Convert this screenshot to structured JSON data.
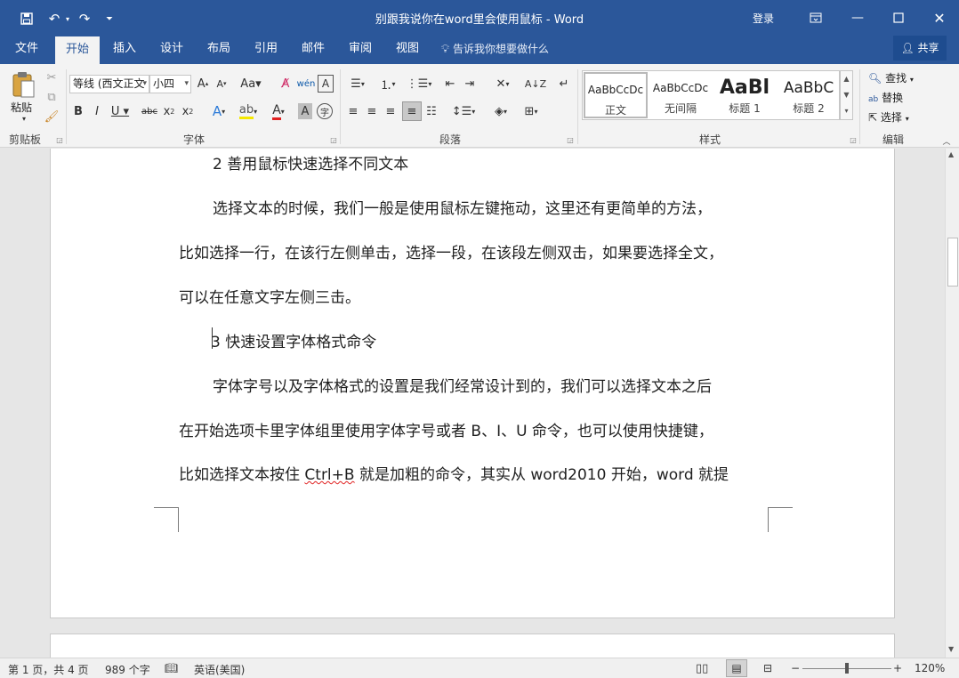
{
  "window": {
    "title": "别跟我说你在word里会使用鼠标  -  Word",
    "login": "登录",
    "share": "共享",
    "tell_me": "告诉我你想要做什么"
  },
  "tabs": [
    {
      "label": "文件"
    },
    {
      "label": "开始",
      "active": true
    },
    {
      "label": "插入"
    },
    {
      "label": "设计"
    },
    {
      "label": "布局"
    },
    {
      "label": "引用"
    },
    {
      "label": "邮件"
    },
    {
      "label": "审阅"
    },
    {
      "label": "视图"
    }
  ],
  "ribbon": {
    "clipboard": {
      "paste": "粘贴",
      "label": "剪贴板"
    },
    "font": {
      "name": "等线 (西文正文",
      "size": "小四",
      "label": "字体"
    },
    "paragraph": {
      "label": "段落"
    },
    "styles": {
      "label": "样式",
      "items": [
        {
          "preview": "AaBbCcDc",
          "name": "正文",
          "selected": true
        },
        {
          "preview": "AaBbCcDc",
          "name": "无间隔"
        },
        {
          "preview": "AaBl",
          "name": "标题 1"
        },
        {
          "preview": "AaBbC",
          "name": "标题 2"
        }
      ]
    },
    "editing": {
      "find": "查找",
      "replace": "替换",
      "select": "选择",
      "label": "编辑"
    }
  },
  "document": {
    "lines": [
      "2 善用鼠标快速选择不同文本",
      "选择文本的时候，我们一般是使用鼠标左键拖动，这里还有更简单的方法，",
      "比如选择一行，在该行左侧单击，选择一段，在该段左侧双击，如果要选择全文，",
      "可以在任意文字左侧三击。",
      "3 快速设置字体格式命令",
      "字体字号以及字体格式的设置是我们经常设计到的，我们可以选择文本之后",
      "在开始选项卡里字体组里使用字体字号或者 B、I、U 命令，也可以使用快捷键，",
      "比如选择文本按住",
      "Ctrl+B",
      "就是加粗的命令，其实从 word2010 开始，word 就提"
    ]
  },
  "status": {
    "page": "第 1 页，共 4 页",
    "words": "989 个字",
    "language": "英语(美国)",
    "zoom": "120%"
  }
}
